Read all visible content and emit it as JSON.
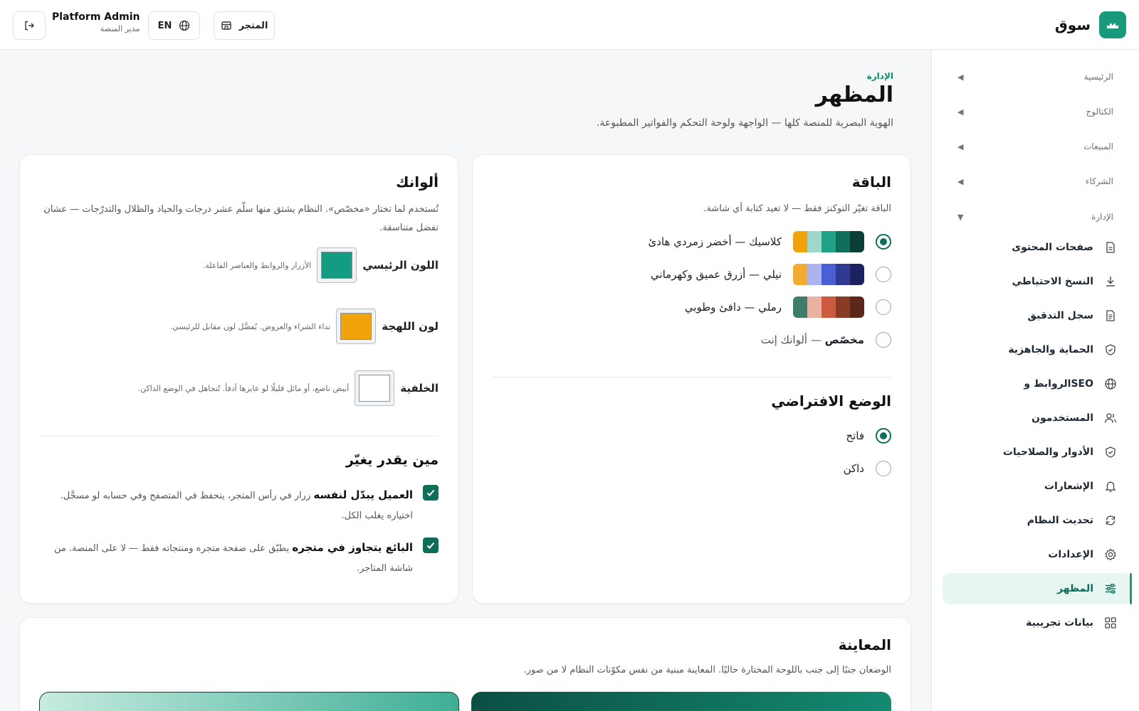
{
  "brand": {
    "name": "سوق",
    "logo_icon": "store-logo-icon",
    "color": "#1a9a7d"
  },
  "header": {
    "store_label": "المتجر",
    "lang_label": "EN",
    "admin_name": "Platform Admin",
    "admin_role": "مدير المنصة"
  },
  "sidebar": {
    "sections": [
      {
        "label": "الرئيسية",
        "expanded": false
      },
      {
        "label": "الكتالوج",
        "expanded": false
      },
      {
        "label": "المبيعات",
        "expanded": false
      },
      {
        "label": "الشركاء",
        "expanded": false
      },
      {
        "label": "الإدارة",
        "expanded": true
      }
    ],
    "items": [
      {
        "label": "صفحات المحتوى",
        "icon": "document-icon"
      },
      {
        "label": "النسخ الاحتياطي",
        "icon": "download-icon"
      },
      {
        "label": "سجل التدقيق",
        "icon": "file-text-icon"
      },
      {
        "label": "الحماية والجاهزية",
        "icon": "shield-check-icon"
      },
      {
        "label": "الروابط وSEO",
        "icon": "globe-icon"
      },
      {
        "label": "المستخدمون",
        "icon": "users-icon"
      },
      {
        "label": "الأدوار والصلاحيات",
        "icon": "shield-icon"
      },
      {
        "label": "الإشعارات",
        "icon": "bell-icon"
      },
      {
        "label": "تحديث النظام",
        "icon": "refresh-icon"
      },
      {
        "label": "الإعدادات",
        "icon": "gear-icon"
      },
      {
        "label": "المظهر",
        "icon": "sliders-icon",
        "active": true
      },
      {
        "label": "بيانات تجريبية",
        "icon": "grid-icon"
      }
    ]
  },
  "page": {
    "breadcrumb": "الإدارة",
    "title": "المظهر",
    "subtitle": "الهوية البصرية للمنصة كلها — الواجهة ولوحة التحكم والفواتير المطبوعة."
  },
  "palette_card": {
    "title": "الباقة",
    "desc": "الباقة تغيّر التوكنز فقط — لا تعيد كتابة أي شاشة.",
    "options": [
      {
        "name": "كلاسيك",
        "desc": "أخضر زمردي هادئ",
        "selected": true,
        "colors": [
          "#f0a30a",
          "#9fd8c9",
          "#1fa286",
          "#0e6e5a",
          "#0b3f35"
        ]
      },
      {
        "name": "نيلي",
        "desc": "أزرق عميق وكهرماني",
        "selected": false,
        "colors": [
          "#f2ab2e",
          "#adb3ee",
          "#4a5fd6",
          "#2f3a93",
          "#1c2260"
        ]
      },
      {
        "name": "رملي",
        "desc": "دافئ وطوبي",
        "selected": false,
        "colors": [
          "#3f7d6b",
          "#e9b2a0",
          "#cc5a3e",
          "#8a3b26",
          "#5a2718"
        ]
      },
      {
        "name": "مخصّص",
        "desc": "ألوانك إنت",
        "selected": false,
        "colors": []
      }
    ],
    "mode_title": "الوضع الافتراضي",
    "modes": [
      {
        "label": "فاتح",
        "selected": true
      },
      {
        "label": "داكن",
        "selected": false
      }
    ]
  },
  "colors_card": {
    "title": "ألوانك",
    "desc": "تُستخدم لما تختار «مخصّص». النظام يشتق منها سلّم عشر درجات والحياد والظلال والتدرّجات — عشان تفضل متناسقة.",
    "fields": [
      {
        "label": "اللون الرئيسي",
        "hint": "الأزرار والروابط والعناصر الفاعلة.",
        "value": "#149b83"
      },
      {
        "label": "لون اللهجة",
        "hint": "نداء الشراء والعروض. يُفضَّل لون مقابل للرئيسي.",
        "value": "#f0a30a"
      },
      {
        "label": "الخلفية",
        "hint": "أبيض ناصع، أو مائل قليلًا لو عايزها أدفأ. تُتجاهل في الوضع الداكن.",
        "value": "#ffffff"
      }
    ],
    "who_title": "مين يقدر يغيّر",
    "permissions": [
      {
        "title": "العميل يبدّل لنفسه",
        "desc": "زرار في رأس المتجر، يتحفظ في المتصفح وفي حسابه لو مسجَّل. اختياره يغلب الكل.",
        "checked": true
      },
      {
        "title": "البائع يتجاوز في متجره",
        "desc": "يطبّق على صفحة متجره ومنتجاته فقط — لا على المنصة. من شاشة المتاجر.",
        "checked": true
      }
    ]
  },
  "preview_card": {
    "title": "المعاينة",
    "desc": "الوضعان جنبًا إلى جنب باللوحة المختارة حاليًا. المعاينة مبنية من نفس مكوّنات النظام لا من صور."
  }
}
